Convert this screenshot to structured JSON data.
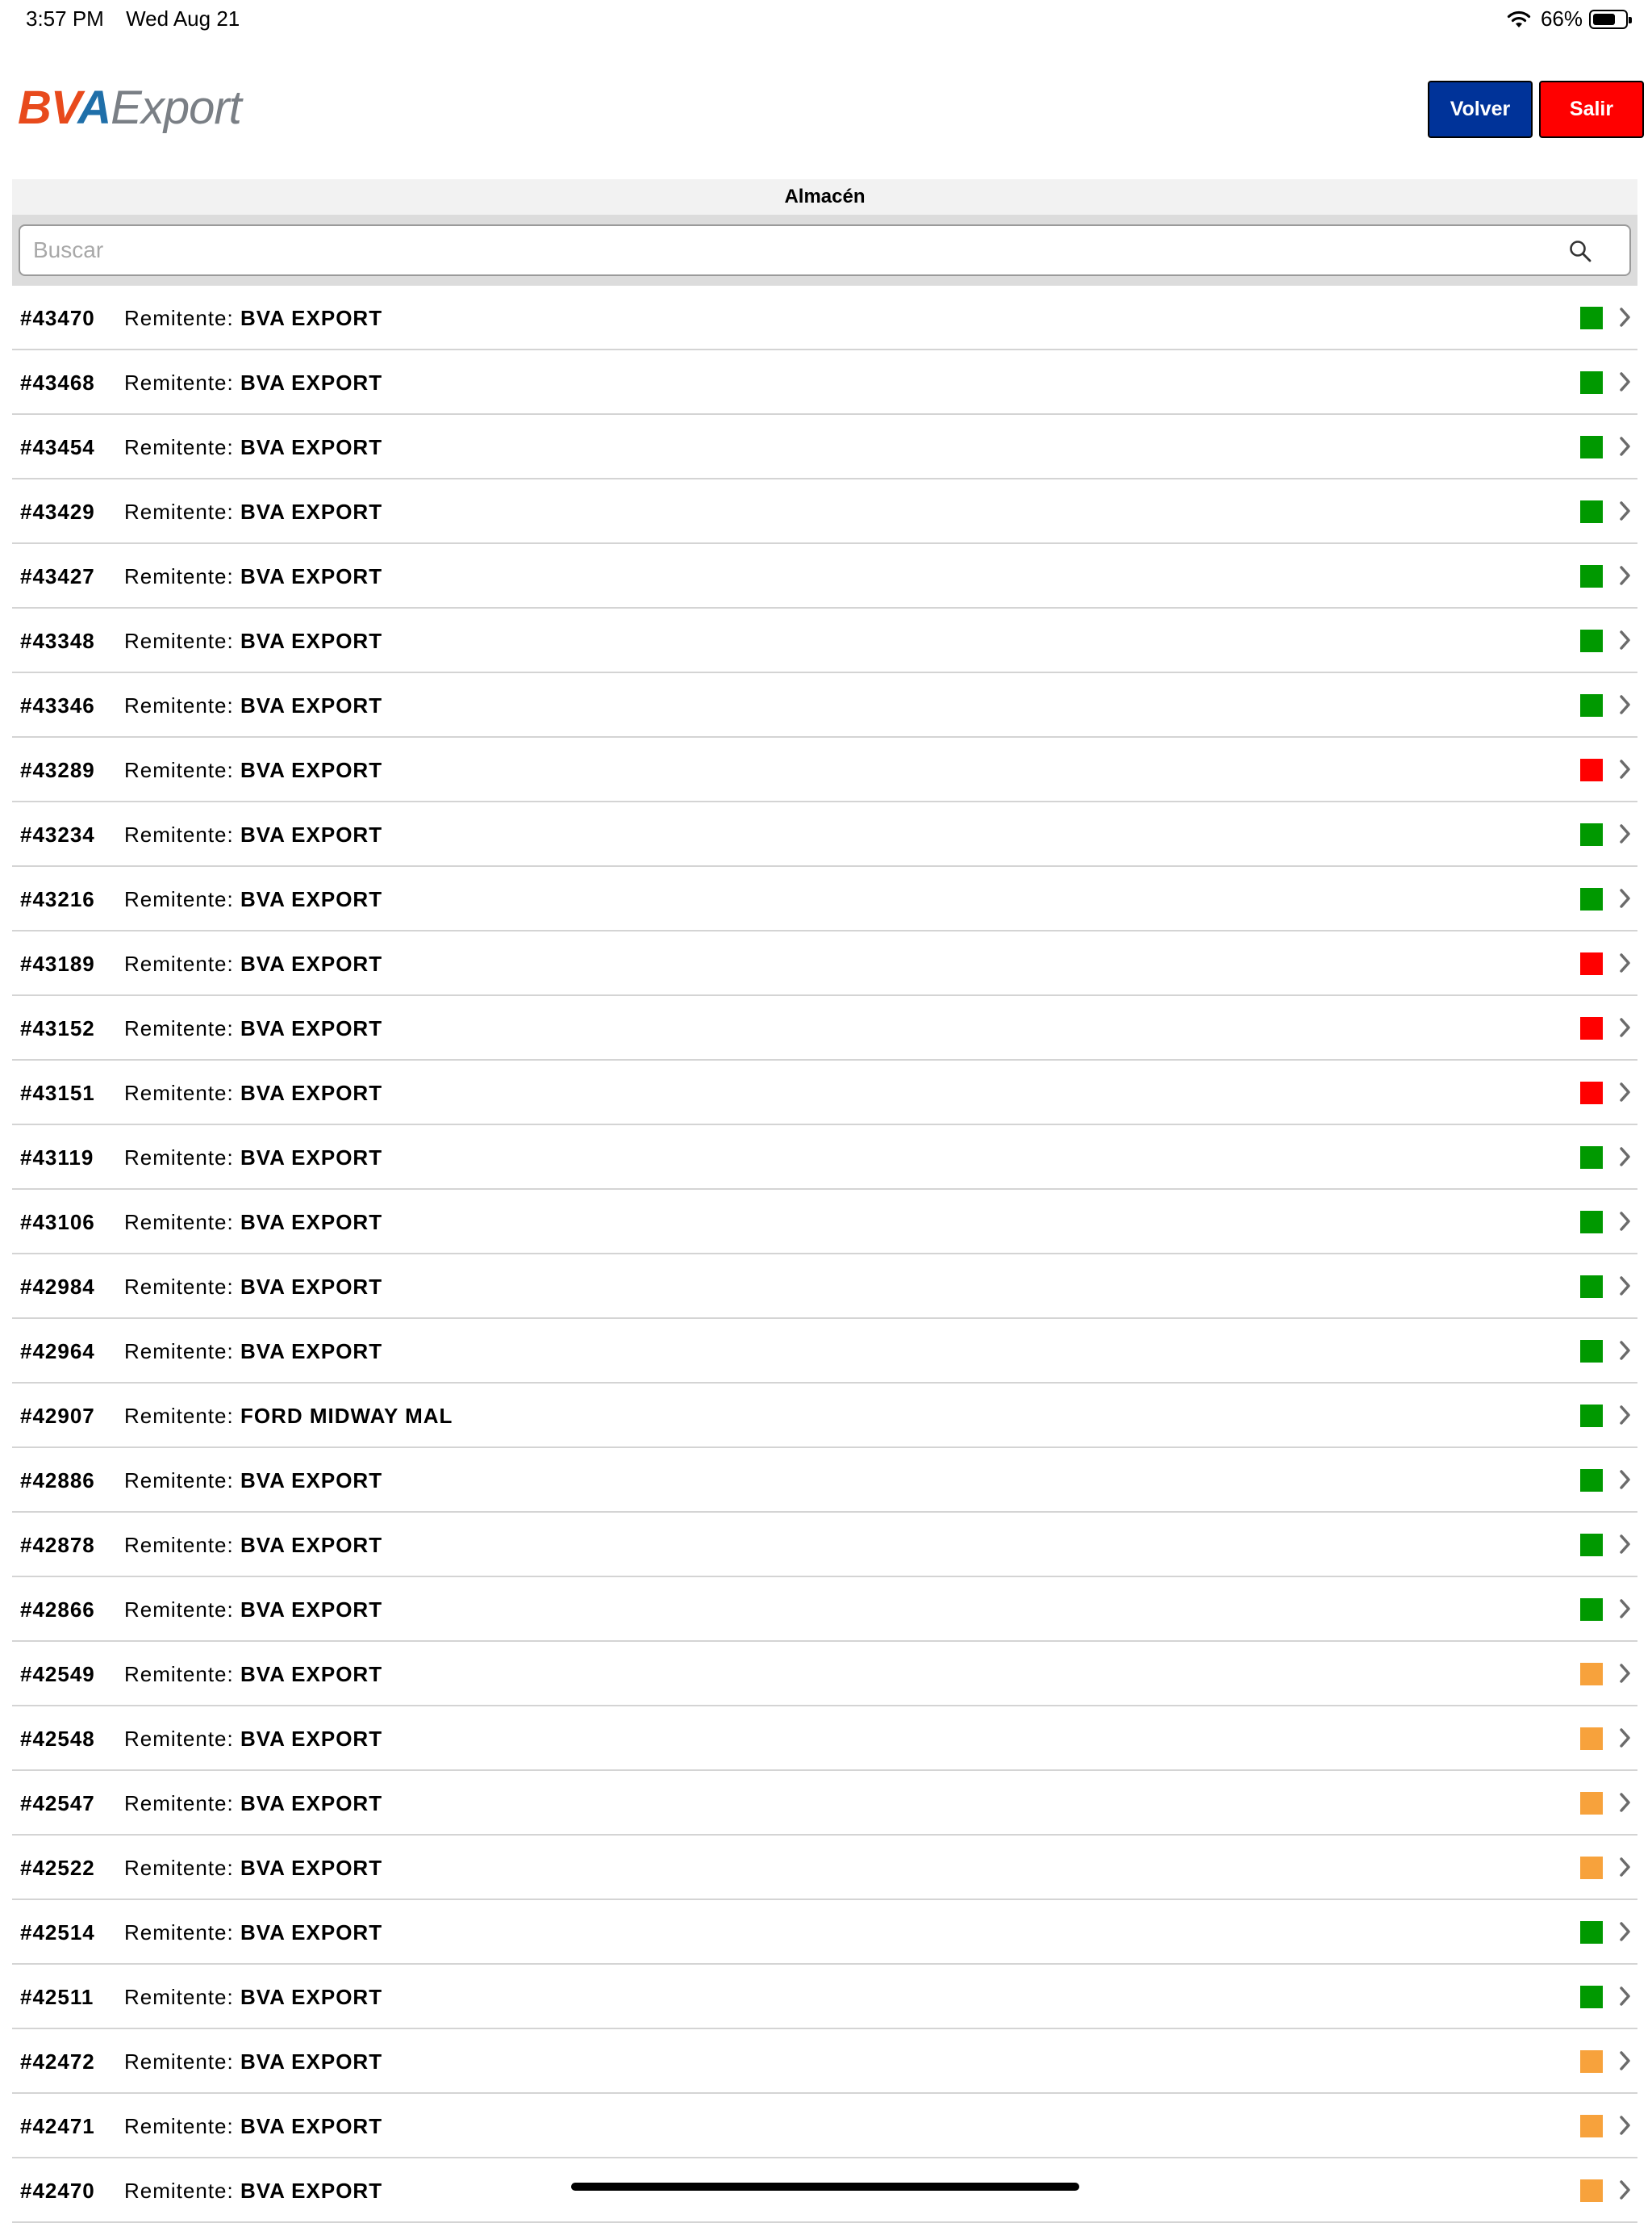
{
  "status_bar": {
    "time": "3:57 PM",
    "date": "Wed Aug 21",
    "battery": "66%"
  },
  "header": {
    "logo_bva_1": "BV",
    "logo_bva_2": "A",
    "logo_export": "Export",
    "back_label": "Volver",
    "exit_label": "Salir"
  },
  "section": {
    "title": "Almacén"
  },
  "search": {
    "placeholder": "Buscar",
    "value": ""
  },
  "list": {
    "sender_label": "Remitente: ",
    "status_colors": {
      "green": "#009900",
      "red": "#ff0000",
      "orange": "#f7a23c"
    },
    "rows": [
      {
        "id": "#43470",
        "sender": "BVA EXPORT",
        "status": "green"
      },
      {
        "id": "#43468",
        "sender": "BVA EXPORT",
        "status": "green"
      },
      {
        "id": "#43454",
        "sender": "BVA EXPORT",
        "status": "green"
      },
      {
        "id": "#43429",
        "sender": "BVA EXPORT",
        "status": "green"
      },
      {
        "id": "#43427",
        "sender": "BVA EXPORT",
        "status": "green"
      },
      {
        "id": "#43348",
        "sender": "BVA EXPORT",
        "status": "green"
      },
      {
        "id": "#43346",
        "sender": "BVA EXPORT",
        "status": "green"
      },
      {
        "id": "#43289",
        "sender": "BVA EXPORT",
        "status": "red"
      },
      {
        "id": "#43234",
        "sender": "BVA EXPORT",
        "status": "green"
      },
      {
        "id": "#43216",
        "sender": "BVA EXPORT",
        "status": "green"
      },
      {
        "id": "#43189",
        "sender": "BVA EXPORT",
        "status": "red"
      },
      {
        "id": "#43152",
        "sender": "BVA EXPORT",
        "status": "red"
      },
      {
        "id": "#43151",
        "sender": "BVA EXPORT",
        "status": "red"
      },
      {
        "id": "#43119",
        "sender": "BVA EXPORT",
        "status": "green"
      },
      {
        "id": "#43106",
        "sender": "BVA EXPORT",
        "status": "green"
      },
      {
        "id": "#42984",
        "sender": "BVA EXPORT",
        "status": "green"
      },
      {
        "id": "#42964",
        "sender": "BVA EXPORT",
        "status": "green"
      },
      {
        "id": "#42907",
        "sender": "FORD MIDWAY MAL",
        "status": "green"
      },
      {
        "id": "#42886",
        "sender": "BVA EXPORT",
        "status": "green"
      },
      {
        "id": "#42878",
        "sender": "BVA EXPORT",
        "status": "green"
      },
      {
        "id": "#42866",
        "sender": "BVA EXPORT",
        "status": "green"
      },
      {
        "id": "#42549",
        "sender": "BVA EXPORT",
        "status": "orange"
      },
      {
        "id": "#42548",
        "sender": "BVA EXPORT",
        "status": "orange"
      },
      {
        "id": "#42547",
        "sender": "BVA EXPORT",
        "status": "orange"
      },
      {
        "id": "#42522",
        "sender": "BVA EXPORT",
        "status": "orange"
      },
      {
        "id": "#42514",
        "sender": "BVA EXPORT",
        "status": "green"
      },
      {
        "id": "#42511",
        "sender": "BVA EXPORT",
        "status": "green"
      },
      {
        "id": "#42472",
        "sender": "BVA EXPORT",
        "status": "orange"
      },
      {
        "id": "#42471",
        "sender": "BVA EXPORT",
        "status": "orange"
      },
      {
        "id": "#42470",
        "sender": "BVA EXPORT",
        "status": "orange"
      }
    ]
  }
}
